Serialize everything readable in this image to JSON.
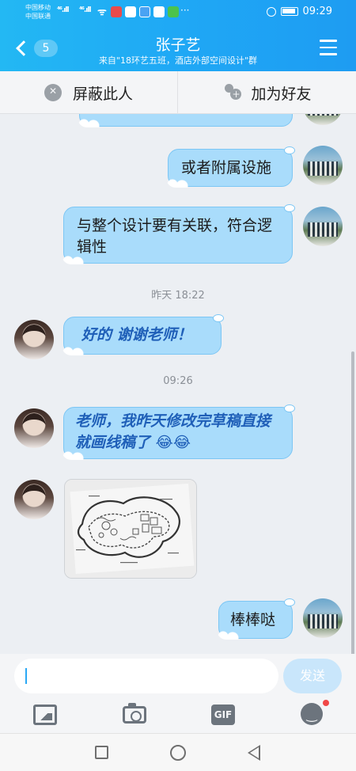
{
  "status_bar": {
    "carrier_1": "中国移动",
    "carrier_2": "中国联通",
    "signal_1": "⁴⁶.ıll",
    "signal_2": "⁴⁶.ıll",
    "wifi": "ᯤ",
    "more": "···",
    "time": "09:29"
  },
  "header": {
    "back_count": "5",
    "title": "张子艺",
    "subtitle": "来自\"18环艺五班，酒店外部空间设计\"群"
  },
  "actions": {
    "block_label": "屏蔽此人",
    "add_friend_label": "加为好友"
  },
  "messages": [
    {
      "side": "out",
      "text": "或者附属设施"
    },
    {
      "side": "out",
      "text": "与整个设计要有关联，符合逻辑性"
    },
    {
      "side": "time",
      "text": "昨天 18:22"
    },
    {
      "side": "in",
      "text": "好的 谢谢老师！"
    },
    {
      "side": "time",
      "text": "09:26"
    },
    {
      "side": "in",
      "text": "老师，我昨天修改完草稿直接就画线稿了 😂😂"
    },
    {
      "side": "in",
      "type": "image",
      "text": ""
    },
    {
      "side": "out",
      "text": "棒棒哒"
    }
  ],
  "input": {
    "value": "",
    "send_label": "发送"
  },
  "toolbar": {
    "gif_label": "GIF"
  },
  "colors": {
    "header_bg": "#1fa8f5",
    "bubble_bg": "#a9dcfb",
    "incoming_text": "#1f5fb8"
  },
  "icons": [
    "back-chevron-icon",
    "menu-icon",
    "block-icon",
    "add-friend-icon",
    "image-icon",
    "camera-icon",
    "gif-icon",
    "emoji-icon"
  ]
}
